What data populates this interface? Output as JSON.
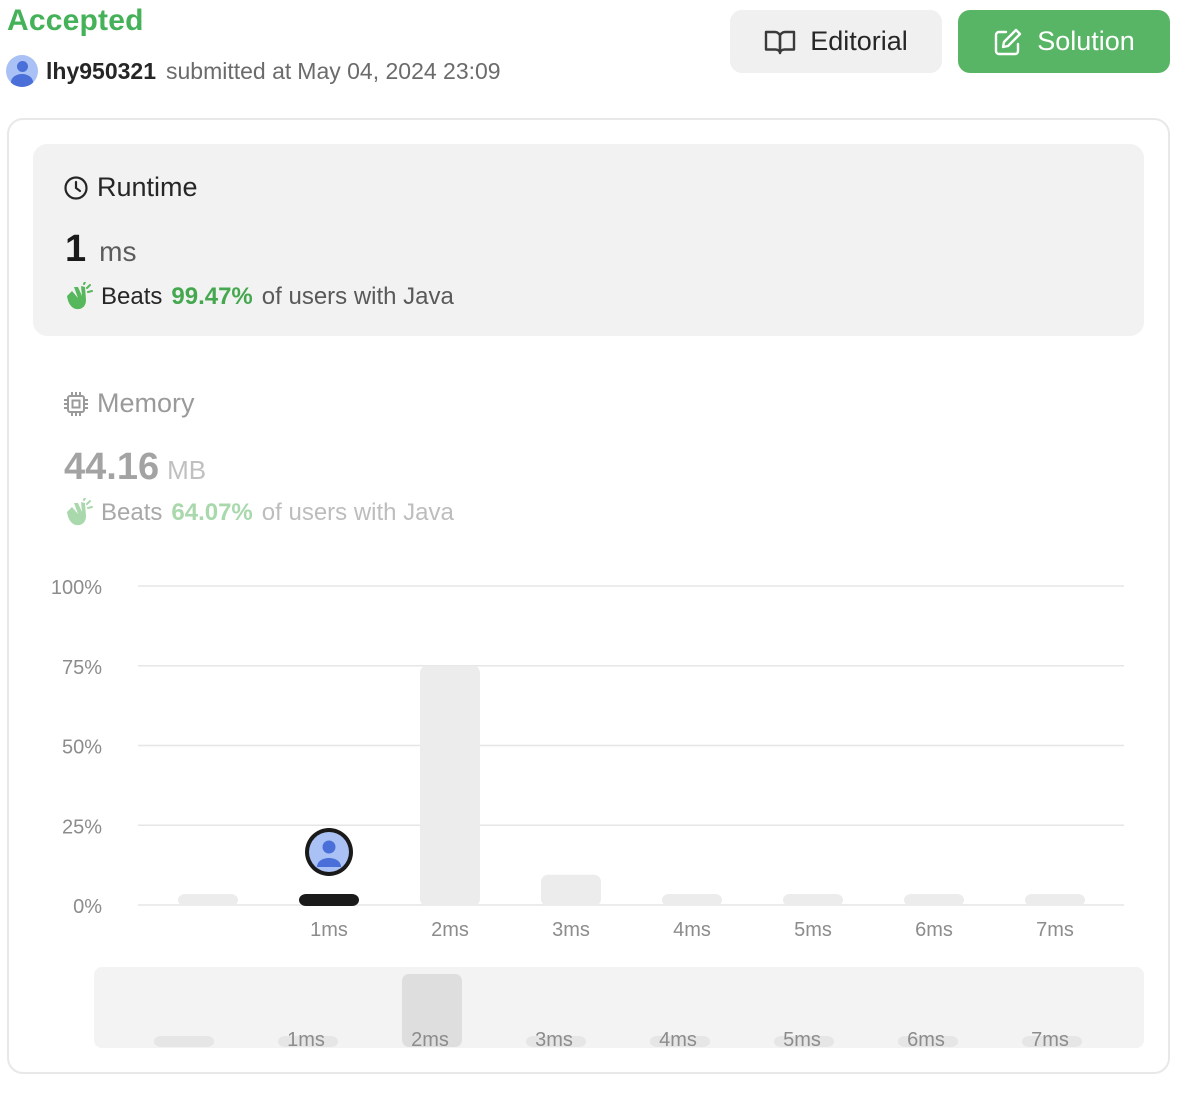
{
  "header": {
    "status": "Accepted",
    "username": "lhy950321",
    "submitted_prefix": "submitted at",
    "submitted_date": "May 04, 2024 23:09"
  },
  "buttons": {
    "editorial_label": "Editorial",
    "solution_label": "Solution"
  },
  "runtime": {
    "title": "Runtime",
    "value": "1",
    "unit": "ms",
    "beats_label": "Beats",
    "beats_pct": "99.47%",
    "beats_suffix": "of users with Java"
  },
  "memory": {
    "title": "Memory",
    "value": "44.16",
    "unit": "MB",
    "beats_label": "Beats",
    "beats_pct": "64.07%",
    "beats_suffix": "of users with Java"
  },
  "colors": {
    "accent_green": "#45b159",
    "solution_button": "#58b565",
    "bar_default": "#ececec",
    "bar_selected": "#1a1a1a",
    "avatar_blue": "#4a6fd8"
  },
  "icons": {
    "editorial": "book-open-icon",
    "solution": "edit-icon",
    "runtime": "clock-icon",
    "memory": "cpu-chip-icon",
    "beats": "clapping-hands-icon"
  },
  "chart_data": {
    "type": "bar",
    "categories": [
      "",
      "1ms",
      "2ms",
      "3ms",
      "4ms",
      "5ms",
      "6ms",
      "7ms"
    ],
    "values": [
      0.5,
      0.5,
      75,
      9.5,
      0.5,
      0.5,
      0.5,
      0.5
    ],
    "ylim": [
      0,
      100
    ],
    "yticks": [
      "100%",
      "75%",
      "50%",
      "25%",
      "0%"
    ],
    "selected_category": "1ms",
    "grid": true,
    "navigator_categories": [
      "",
      "1ms",
      "2ms",
      "3ms",
      "4ms",
      "5ms",
      "6ms",
      "7ms"
    ]
  }
}
